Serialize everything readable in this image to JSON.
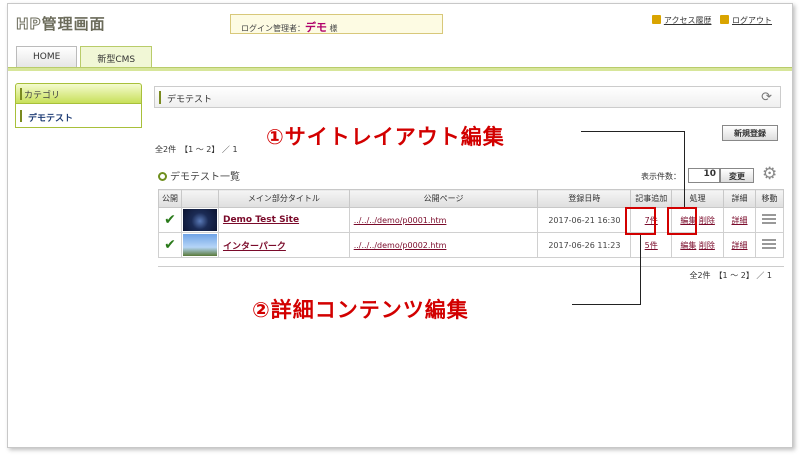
{
  "header": {
    "logo_text_hp": "HP",
    "logo_text_main": "管理画面",
    "login_label": "ログイン管理者：",
    "login_user": "デモ",
    "login_suffix": "様",
    "access_log": "アクセス履歴",
    "logout": "ログアウト"
  },
  "tabs": [
    {
      "label": "HOME"
    },
    {
      "label": "新型CMS"
    }
  ],
  "sidebar": {
    "heading": "カテゴリ",
    "items": [
      {
        "label": "デモテスト"
      }
    ]
  },
  "main": {
    "page_title": "デモテスト",
    "new_button": "新規登録",
    "count_top": "全2件　【1 ～ 2】 ／ 1",
    "count_bottom": "全2件　【1 ～ 2】 ／ 1",
    "list_title": "デモテスト一覧",
    "display_count_label": "表示件数：",
    "display_count_value": "10",
    "change_button": "変更",
    "columns": [
      "公開",
      "",
      "メイン部分タイトル",
      "公開ページ",
      "登録日時",
      "記事追加",
      "処理",
      "詳細",
      "移動"
    ],
    "rows": [
      {
        "title": "Demo Test Site",
        "url": "../../../demo/p0001.htm",
        "date": "2017-06-21 16:30",
        "articles": "7件",
        "edit": "編集",
        "delete": "削除",
        "detail": "詳細"
      },
      {
        "title": "インターパーク",
        "url": "../../../demo/p0002.htm",
        "date": "2017-06-26 11:23",
        "articles": "5件",
        "edit": "編集",
        "delete": "削除",
        "detail": "詳細"
      }
    ]
  },
  "annotations": {
    "one": "①サイトレイアウト編集",
    "two": "②詳細コンテンツ編集",
    "color": "#d20000"
  }
}
